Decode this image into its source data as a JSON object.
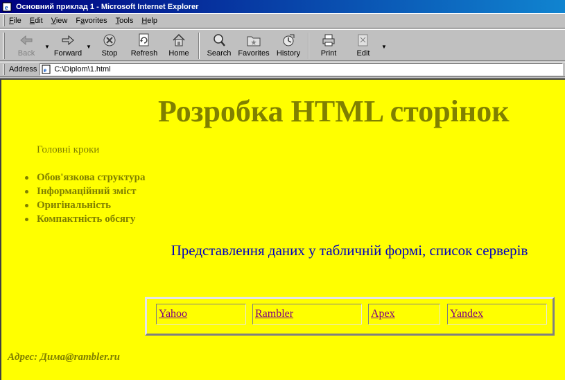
{
  "window": {
    "title": "Основний приклад 1 - Microsoft Internet Explorer"
  },
  "menu": [
    {
      "label": "File",
      "key": "F",
      "rest": "ile"
    },
    {
      "label": "Edit",
      "key": "E",
      "rest": "dit"
    },
    {
      "label": "View",
      "key": "V",
      "rest": "iew"
    },
    {
      "label": "Favorites",
      "key": "a",
      "pre": "F",
      "rest": "vorites"
    },
    {
      "label": "Tools",
      "key": "T",
      "rest": "ools"
    },
    {
      "label": "Help",
      "key": "H",
      "rest": "elp"
    }
  ],
  "toolbar": {
    "back": "Back",
    "forward": "Forward",
    "stop": "Stop",
    "refresh": "Refresh",
    "home": "Home",
    "search": "Search",
    "favorites": "Favorites",
    "history": "History",
    "print": "Print",
    "edit": "Edit"
  },
  "address": {
    "label": "Address",
    "value": "C:\\Diplom\\1.html"
  },
  "page": {
    "title": "Розробка HTML сторінок",
    "steps_heading": "Головні кроки",
    "steps": [
      "Обов'язкова структура",
      "Інформаційний зміст",
      "Оригінальність",
      "Компактність обсягу"
    ],
    "subheading": "Представлення даних у табличній формі, список серверів",
    "servers": [
      "Yahoo",
      "Rambler",
      "Apex",
      "Yandex"
    ],
    "address_line": "Адрес: Дима@rambler.ru"
  },
  "colors": {
    "page_bg": "#ffff00",
    "olive": "#808000",
    "blue": "#0000c0",
    "link_visited": "#800080"
  }
}
